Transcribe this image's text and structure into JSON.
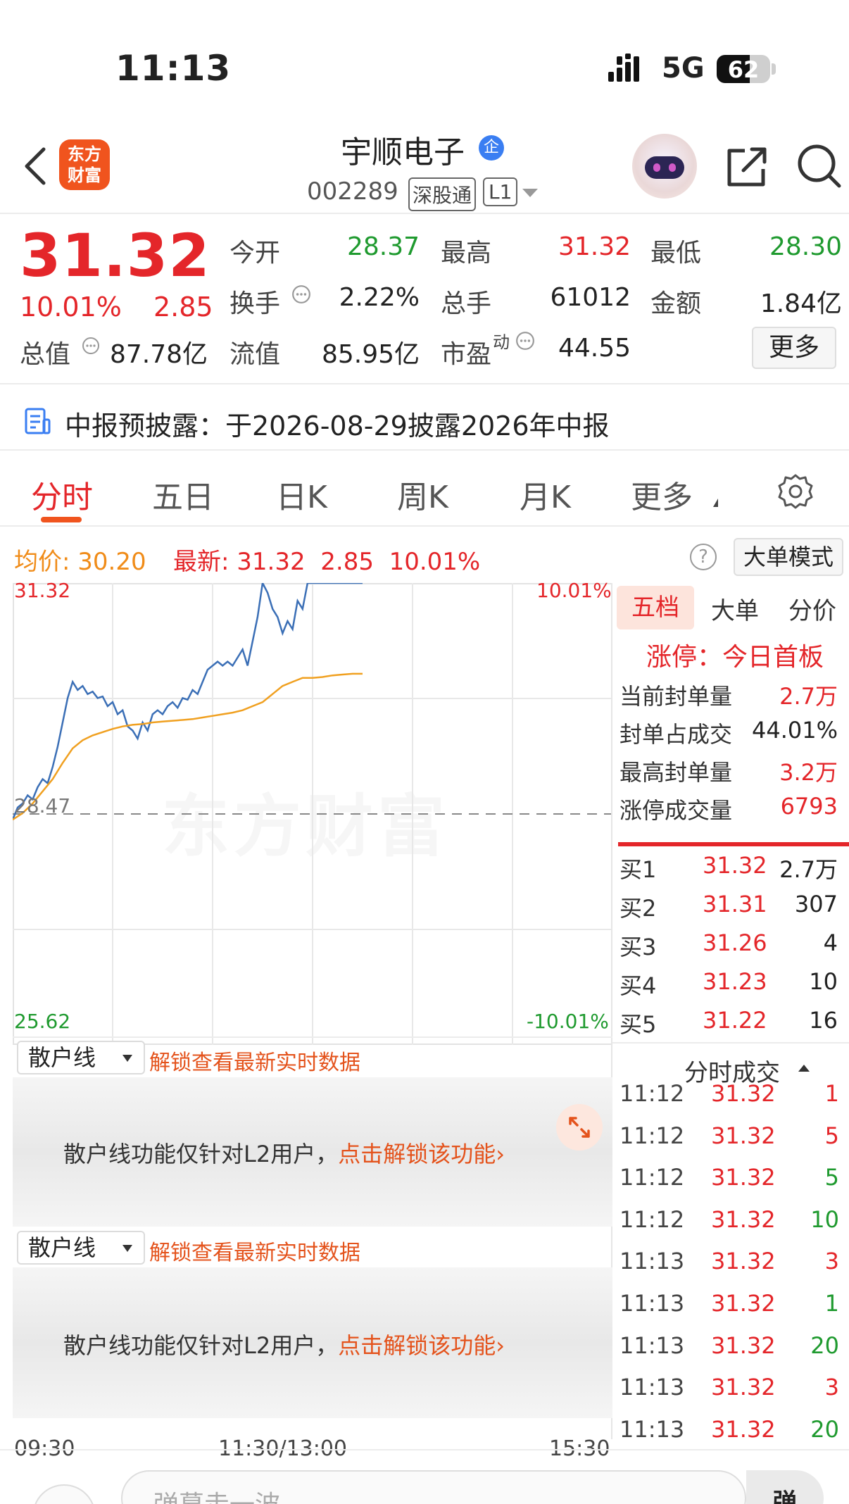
{
  "status_bar": {
    "time": "11:13",
    "network": "5G",
    "battery": "62"
  },
  "header": {
    "logo_line1": "东方",
    "logo_line2": "财富",
    "stock_name": "宇顺电子",
    "verified_badge": "企",
    "stock_code": "002289",
    "tag_connect": "深股通",
    "tag_level": "L1"
  },
  "quote": {
    "price": "31.32",
    "change_pct": "10.01%",
    "change_amt": "2.85",
    "total_value_label": "总值",
    "total_value": "87.78亿",
    "open_label": "今开",
    "open": "28.37",
    "high_label": "最高",
    "high": "31.32",
    "low_label": "最低",
    "low": "28.30",
    "turnover_label": "换手",
    "turnover": "2.22%",
    "volume_label": "总手",
    "volume": "61012",
    "amount_label": "金额",
    "amount": "1.84亿",
    "float_label": "流值",
    "float_value": "85.95亿",
    "pe_label": "市盈",
    "pe_sup": "动",
    "pe": "44.55",
    "more_label": "更多"
  },
  "notice": {
    "text": "中报预披露：于2026-08-29披露2026年中报"
  },
  "tabs": [
    "分时",
    "五日",
    "日K",
    "周K",
    "月K",
    "更多"
  ],
  "chart_header": {
    "avg_label": "均价:",
    "avg_value": "30.20",
    "latest_label": "最新:",
    "latest_value": "31.32",
    "latest_change": "2.85",
    "latest_pct": "10.01%",
    "help": "?",
    "big_order_mode": "大单模式"
  },
  "chart_data": {
    "type": "line",
    "y_labels_left": [
      "31.32",
      "28.47",
      "25.62"
    ],
    "y_labels_right": [
      "10.01%",
      "-10.01%"
    ],
    "x_labels": [
      "09:30",
      "11:30/13:00",
      "15:30"
    ],
    "ylim": [
      25.62,
      31.32
    ],
    "prev_close": 28.47,
    "x_minutes_total": 240,
    "series": [
      {
        "color": "#3b6fb6",
        "x": [
          0,
          2,
          4,
          6,
          8,
          10,
          12,
          14,
          16,
          18,
          20,
          22,
          24,
          26,
          28,
          30,
          32,
          34,
          36,
          38,
          40,
          42,
          44,
          46,
          48,
          50,
          52,
          54,
          56,
          58,
          60,
          62,
          64,
          66,
          68,
          70,
          72,
          74,
          76,
          78,
          80,
          82,
          84,
          86,
          88,
          90,
          92,
          94,
          96,
          98,
          100,
          102,
          104,
          106,
          108,
          110,
          112,
          114,
          116,
          118,
          120,
          122,
          124,
          126,
          128,
          130,
          132,
          134,
          136,
          138,
          140
        ],
        "values": [
          28.4,
          28.55,
          28.6,
          28.7,
          28.65,
          28.8,
          28.9,
          28.85,
          29.05,
          29.3,
          29.6,
          29.9,
          30.1,
          30.0,
          30.05,
          29.95,
          29.98,
          29.9,
          29.92,
          29.8,
          29.85,
          29.7,
          29.75,
          29.55,
          29.5,
          29.4,
          29.6,
          29.5,
          29.7,
          29.75,
          29.7,
          29.8,
          29.85,
          29.78,
          29.9,
          29.88,
          30.0,
          29.95,
          30.1,
          30.25,
          30.3,
          30.35,
          30.3,
          30.35,
          30.3,
          30.4,
          30.5,
          30.3,
          30.6,
          30.9,
          31.32,
          31.2,
          31.0,
          30.9,
          30.7,
          30.85,
          30.75,
          31.1,
          31.0,
          31.32,
          31.32,
          31.32,
          31.32,
          31.32,
          31.32,
          31.32,
          31.32,
          31.32,
          31.32,
          31.32,
          31.32
        ]
      },
      {
        "color": "#f0a020",
        "x": [
          0,
          4,
          8,
          12,
          16,
          20,
          24,
          28,
          32,
          36,
          40,
          44,
          48,
          52,
          56,
          60,
          64,
          68,
          72,
          76,
          80,
          84,
          88,
          92,
          96,
          100,
          104,
          108,
          112,
          116,
          120,
          124,
          128,
          132,
          136,
          140
        ],
        "values": [
          28.4,
          28.48,
          28.6,
          28.75,
          28.9,
          29.1,
          29.28,
          29.38,
          29.44,
          29.48,
          29.52,
          29.55,
          29.57,
          29.58,
          29.6,
          29.61,
          29.62,
          29.63,
          29.64,
          29.66,
          29.68,
          29.7,
          29.72,
          29.75,
          29.8,
          29.85,
          29.95,
          30.05,
          30.1,
          30.15,
          30.15,
          30.16,
          30.18,
          30.19,
          30.2,
          30.2
        ]
      }
    ]
  },
  "watermark": "东方财富",
  "right_panel": {
    "tabs": [
      "五档",
      "大单",
      "分价"
    ],
    "limit_title": "涨停：今日首板",
    "seal_rows": [
      {
        "label": "当前封单量",
        "value": "2.7万",
        "color": "#e4262a"
      },
      {
        "label": "封单占成交",
        "value": "44.01%",
        "color": "#222222"
      },
      {
        "label": "最高封单量",
        "value": "3.2万",
        "color": "#e4262a"
      },
      {
        "label": "涨停成交量",
        "value": "6793",
        "color": "#e4262a"
      }
    ],
    "order_book": [
      {
        "label": "买1",
        "price": "31.32",
        "volume": "2.7万"
      },
      {
        "label": "买2",
        "price": "31.31",
        "volume": "307"
      },
      {
        "label": "买3",
        "price": "31.26",
        "volume": "4"
      },
      {
        "label": "买4",
        "price": "31.23",
        "volume": "10"
      },
      {
        "label": "买5",
        "price": "31.22",
        "volume": "16"
      }
    ],
    "trades_title": "分时成交",
    "trades": [
      {
        "time": "11:12",
        "price": "31.32",
        "volume": "1",
        "color": "#e4262a"
      },
      {
        "time": "11:12",
        "price": "31.32",
        "volume": "5",
        "color": "#e4262a"
      },
      {
        "time": "11:12",
        "price": "31.32",
        "volume": "5",
        "color": "#1f9a2f"
      },
      {
        "time": "11:12",
        "price": "31.32",
        "volume": "10",
        "color": "#1f9a2f"
      },
      {
        "time": "11:13",
        "price": "31.32",
        "volume": "3",
        "color": "#e4262a"
      },
      {
        "time": "11:13",
        "price": "31.32",
        "volume": "1",
        "color": "#1f9a2f"
      },
      {
        "time": "11:13",
        "price": "31.32",
        "volume": "20",
        "color": "#1f9a2f"
      },
      {
        "time": "11:13",
        "price": "31.32",
        "volume": "3",
        "color": "#e4262a"
      },
      {
        "time": "11:13",
        "price": "31.32",
        "volume": "20",
        "color": "#1f9a2f"
      }
    ]
  },
  "retail": {
    "select_label": "散户线",
    "unlock_link": "解锁查看最新实时数据",
    "l2_text": "散户线功能仅针对L2用户，",
    "l2_link": "点击解锁该功能"
  },
  "bottom_bar": {
    "input_placeholder": "弹幕走一波",
    "send_label": "弹"
  }
}
